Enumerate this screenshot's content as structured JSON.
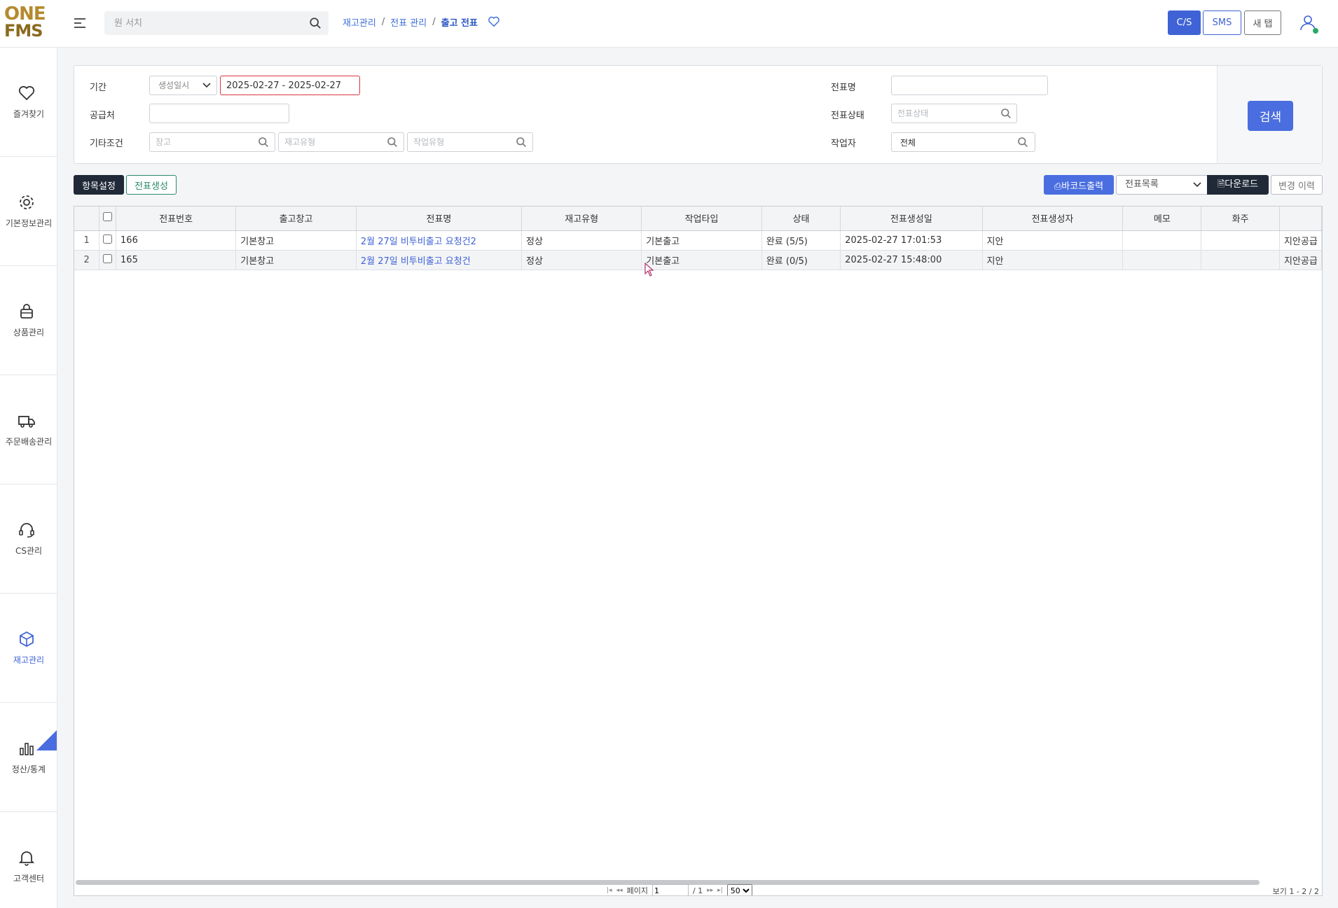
{
  "logo": {
    "line1": "ONE",
    "line2": "FMS"
  },
  "search": {
    "placeholder": "원 서치"
  },
  "breadcrumb": [
    "재고관리",
    "전표 관리",
    "출고 전표"
  ],
  "top_buttons": {
    "cs": "C/S",
    "sms": "SMS",
    "new_tab": "새 탭"
  },
  "sidebar": {
    "items": [
      {
        "label": "즐겨찾기",
        "icon": "heart-icon"
      },
      {
        "label": "기본정보관리",
        "icon": "gear-icon"
      },
      {
        "label": "상품관리",
        "icon": "box-lock-icon"
      },
      {
        "label": "주문배송관리",
        "icon": "truck-icon"
      },
      {
        "label": "CS관리",
        "icon": "headset-icon"
      },
      {
        "label": "재고관리",
        "icon": "cube-icon"
      },
      {
        "label": "정산/통계",
        "icon": "bar-chart-icon"
      },
      {
        "label": "고객센터",
        "icon": "bell-icon"
      }
    ]
  },
  "filters": {
    "period_label": "기간",
    "period_type": "생성일시",
    "date_range": "2025-02-27 - 2025-02-27",
    "supplier_label": "공급처",
    "supplier_value": "",
    "etc_label": "기타조건",
    "warehouse_placeholder": "창고",
    "stock_type_placeholder": "재고유형",
    "work_type_placeholder": "작업유형",
    "slip_name_label": "전표명",
    "slip_name_value": "",
    "slip_status_label": "전표상태",
    "slip_status_placeholder": "전표상태",
    "worker_label": "작업자",
    "worker_value": "전체",
    "search_button": "검색"
  },
  "toolbar": {
    "column_settings": "항목설정",
    "create_slip": "전표생성",
    "barcode_print": "바코드출력",
    "list_select": "전표목록",
    "download": "다운로드",
    "change_history": "변경 이력"
  },
  "table": {
    "columns": [
      "전표번호",
      "출고창고",
      "전표명",
      "재고유형",
      "작업타입",
      "상태",
      "전표생성일",
      "전표생성자",
      "메모",
      "화주",
      ""
    ],
    "rows": [
      {
        "idx": "1",
        "cells": [
          "166",
          "기본창고",
          "2월 27일 비투비출고 요청건2",
          "정상",
          "기본출고",
          "완료 (5/5)",
          "2025-02-27 17:01:53",
          "지안",
          "",
          "",
          "지안공급"
        ]
      },
      {
        "idx": "2",
        "cells": [
          "165",
          "기본창고",
          "2월 27일 비투비출고 요청건",
          "정상",
          "기본출고",
          "완료 (0/5)",
          "2025-02-27 15:48:00",
          "지안",
          "",
          "",
          "지안공급"
        ]
      }
    ]
  },
  "pager": {
    "first": "|◂",
    "prev": "◂◂",
    "page_label": "페이지",
    "page_value": "1",
    "total_pages": "/ 1",
    "next": "▸▸",
    "last": "▸|",
    "page_size": "50",
    "view_count": "보기 1 - 2 / 2"
  },
  "colors": {
    "accent": "#4a6ee0",
    "danger": "#d9363e",
    "green": "#2a8a6b",
    "dark": "#1f2937"
  }
}
